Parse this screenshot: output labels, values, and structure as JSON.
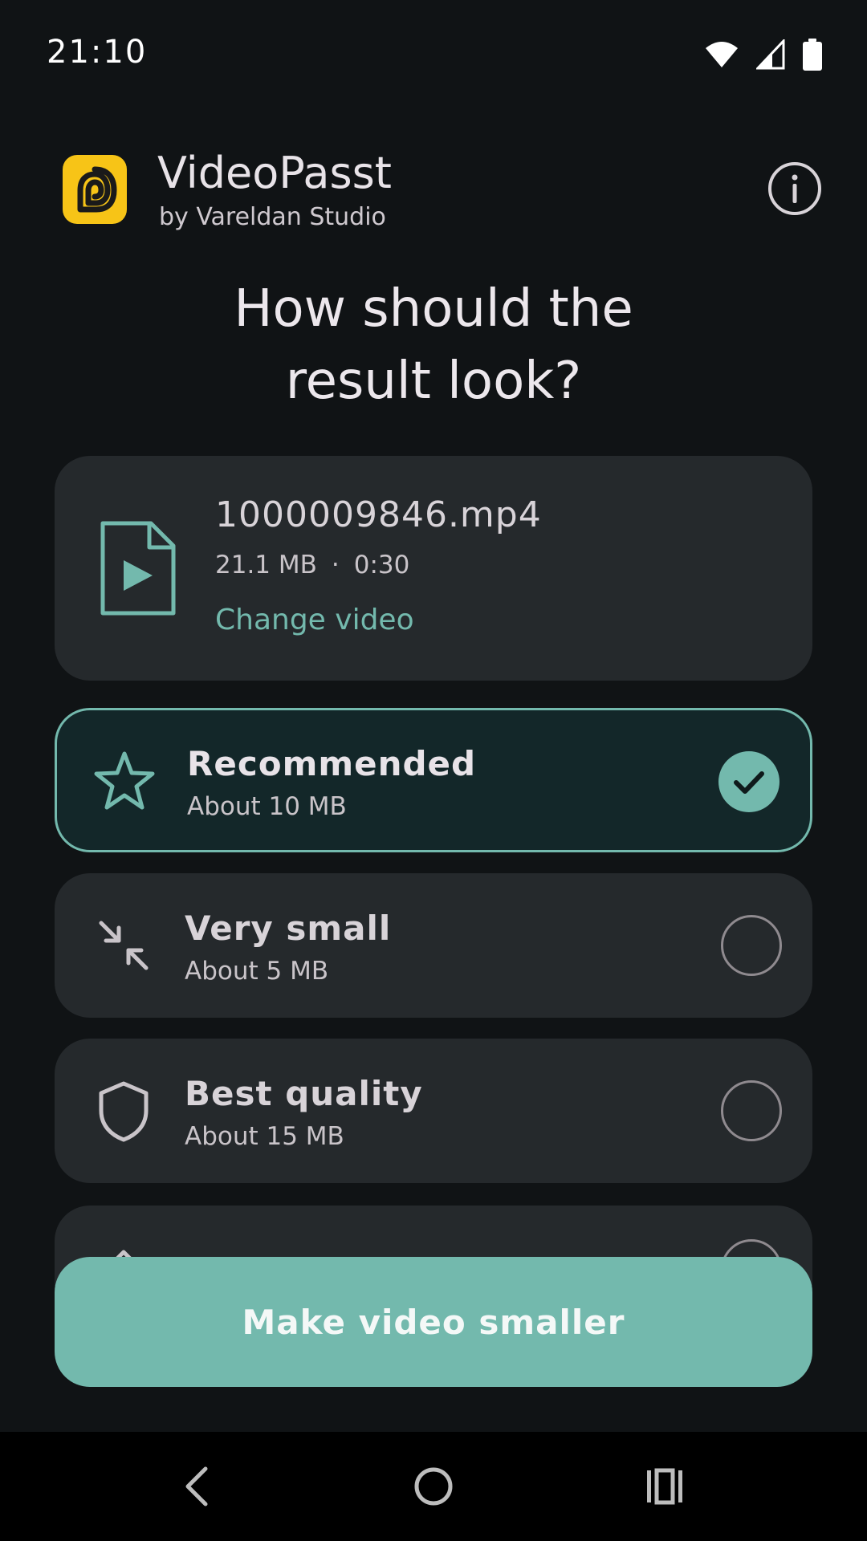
{
  "status_bar": {
    "time": "21:10",
    "icons": [
      "wifi-icon",
      "cell-signal-icon",
      "battery-icon"
    ]
  },
  "app": {
    "title": "VideoPasst",
    "subtitle": "by Vareldan Studio",
    "logo_color": "#f7c417",
    "info_icon": "info-icon"
  },
  "headline": {
    "line1": "How should the",
    "line2": "result look?"
  },
  "file": {
    "name": "1000009846.mp4",
    "size": "21.1 MB",
    "separator": "·",
    "duration": "0:30",
    "change_label": "Change video",
    "icon": "video-file-icon"
  },
  "options": [
    {
      "title": "Recommended",
      "subtitle": "About 10 MB",
      "icon": "star-icon",
      "selected": true
    },
    {
      "title": "Very small",
      "subtitle": "About 5 MB",
      "icon": "compress-arrows-icon",
      "selected": false
    },
    {
      "title": "Best quality",
      "subtitle": "About 15 MB",
      "icon": "shield-icon",
      "selected": false
    }
  ],
  "cta": {
    "label": "Make video smaller"
  },
  "nav": {
    "back": "back-icon",
    "home": "home-icon",
    "recents": "recents-icon"
  },
  "colors": {
    "accent": "#73b9ad",
    "background": "#101315",
    "card": "#25292c",
    "selected_card": "#132729"
  }
}
